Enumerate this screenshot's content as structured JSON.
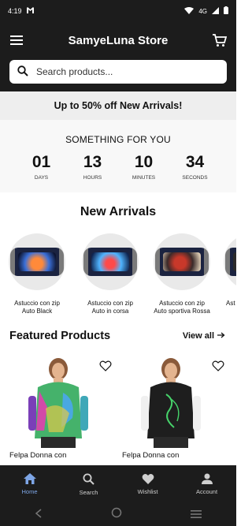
{
  "status": {
    "time": "4:19",
    "network": "4G",
    "carrier_icon": "gmail-icon"
  },
  "header": {
    "title": "SamyeLuna Store"
  },
  "search": {
    "placeholder": "Search products..."
  },
  "promo": {
    "text": "Up to 50% off New Arrivals!"
  },
  "countdown": {
    "heading": "SOMETHING FOR YOU",
    "cells": [
      {
        "value": "01",
        "label": "DAYS"
      },
      {
        "value": "13",
        "label": "HOURS"
      },
      {
        "value": "10",
        "label": "MINUTES"
      },
      {
        "value": "34",
        "label": "SECONDS"
      }
    ]
  },
  "new_arrivals": {
    "title": "New Arrivals",
    "items": [
      {
        "line1": "Astuccio con zip",
        "line2": "Auto Black"
      },
      {
        "line1": "Astuccio con zip",
        "line2": "Auto in corsa"
      },
      {
        "line1": "Astuccio con zip",
        "line2": "Auto sportiva Rossa"
      },
      {
        "line1": "Ast",
        "line2": ""
      }
    ]
  },
  "featured": {
    "title": "Featured Products",
    "view_all": "View all",
    "items": [
      {
        "name": "Felpa Donna con"
      },
      {
        "name": "Felpa Donna con"
      }
    ]
  },
  "bottom_nav": [
    {
      "label": "Home",
      "icon": "home-icon",
      "active": true
    },
    {
      "label": "Search",
      "icon": "search-icon",
      "active": false
    },
    {
      "label": "Wishlist",
      "icon": "heart-icon",
      "active": false
    },
    {
      "label": "Account",
      "icon": "account-icon",
      "active": false
    }
  ],
  "colors": {
    "bar": "#1c1c1c",
    "active_nav": "#7ea6e6"
  }
}
